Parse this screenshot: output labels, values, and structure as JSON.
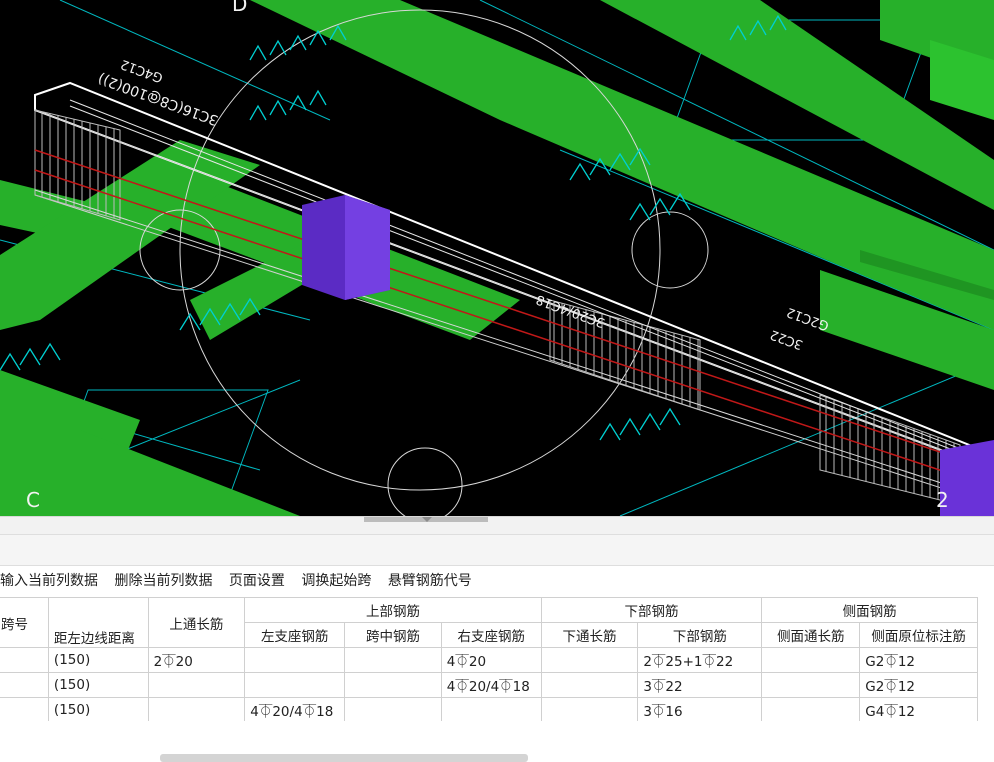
{
  "viewport": {
    "grid_labels": [
      "D",
      "C",
      "2"
    ],
    "beam_annotations": [
      "3C16(C8@100(2))",
      "G4C12",
      "3C22",
      "G2C12",
      "3C20/4C18"
    ],
    "colors": {
      "background": "#000000",
      "beam": "#27b02a",
      "rebar_outline": "#e6e6e6",
      "annotation": "#00cfd1",
      "column": "#6a32d8",
      "axis_line": "#c01818"
    }
  },
  "toolbar": {
    "items": [
      "输入当前列数据",
      "删除当前列数据",
      "页面设置",
      "调换起始跨",
      "悬臂钢筋代号"
    ]
  },
  "table": {
    "headers": {
      "span_no": "跨号",
      "left_distance": "距左边线距离",
      "top_through": "上通长筋",
      "top_group": "上部钢筋",
      "left_support": "左支座钢筋",
      "mid_span": "跨中钢筋",
      "right_support": "右支座钢筋",
      "bottom_group": "下部钢筋",
      "bottom_through": "下通长筋",
      "bottom_bars": "下部钢筋",
      "side_group": "侧面钢筋",
      "side_through": "侧面通长筋",
      "side_original": "侧面原位标注筋"
    },
    "rows": [
      {
        "span_no": "",
        "left_distance": "(150)",
        "top_through": "2⏁20",
        "left_support": "",
        "mid_span": "",
        "right_support": "4⏁20",
        "bottom_through": "",
        "bottom_bars": "2⏁25+1⏁22",
        "side_through": "",
        "side_original": "G2⏁12"
      },
      {
        "span_no": "",
        "left_distance": "(150)",
        "top_through": "",
        "left_support": "",
        "mid_span": "",
        "right_support": "4⏁20/4⏁18",
        "bottom_through": "",
        "bottom_bars": "3⏁22",
        "side_through": "",
        "side_original": "G2⏁12"
      },
      {
        "span_no": "",
        "left_distance": "(150)",
        "top_through": "",
        "left_support": "4⏁20/4⏁18",
        "mid_span": "",
        "right_support": "",
        "bottom_through": "",
        "bottom_bars": "3⏁16",
        "side_through": "",
        "side_original": "G4⏁12"
      }
    ]
  }
}
